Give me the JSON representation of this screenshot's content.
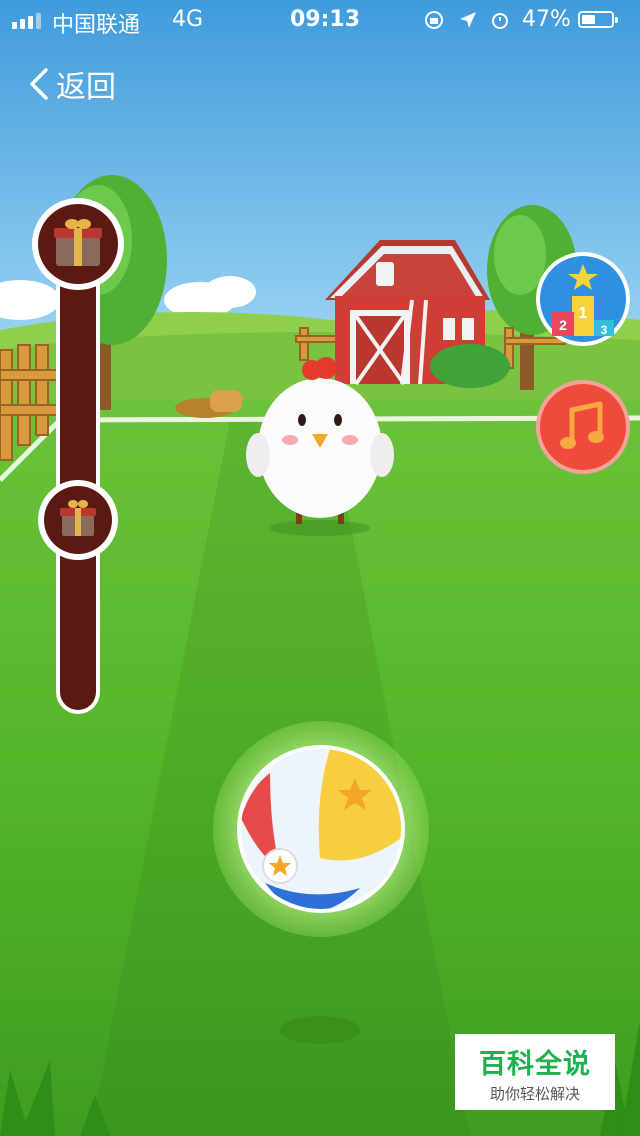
{
  "status_bar": {
    "carrier": "中国联通",
    "network": "4G",
    "time": "09:13",
    "battery": "47%",
    "battery_level": 0.47
  },
  "nav": {
    "back_label": "返回"
  },
  "progress_track": {
    "gift_icons": [
      "gift-icon",
      "gift-icon"
    ]
  },
  "side_buttons": {
    "leaderboard_icon": "podium-icon",
    "podium_numbers": [
      "1",
      "2",
      "3"
    ],
    "music_icon": "music-note-icon"
  },
  "game": {
    "character": "white-chicken",
    "toy": "beach-ball"
  },
  "watermark": {
    "title": "百科全说",
    "subtitle": "助你轻松解决"
  },
  "colors": {
    "sky": "#4aa3df",
    "grass": "#5fbf2e",
    "track": "#5a1a12",
    "music_button": "#f04a3c",
    "leaderboard_button": "#2f8fe0",
    "watermark_green": "#1fb050"
  }
}
